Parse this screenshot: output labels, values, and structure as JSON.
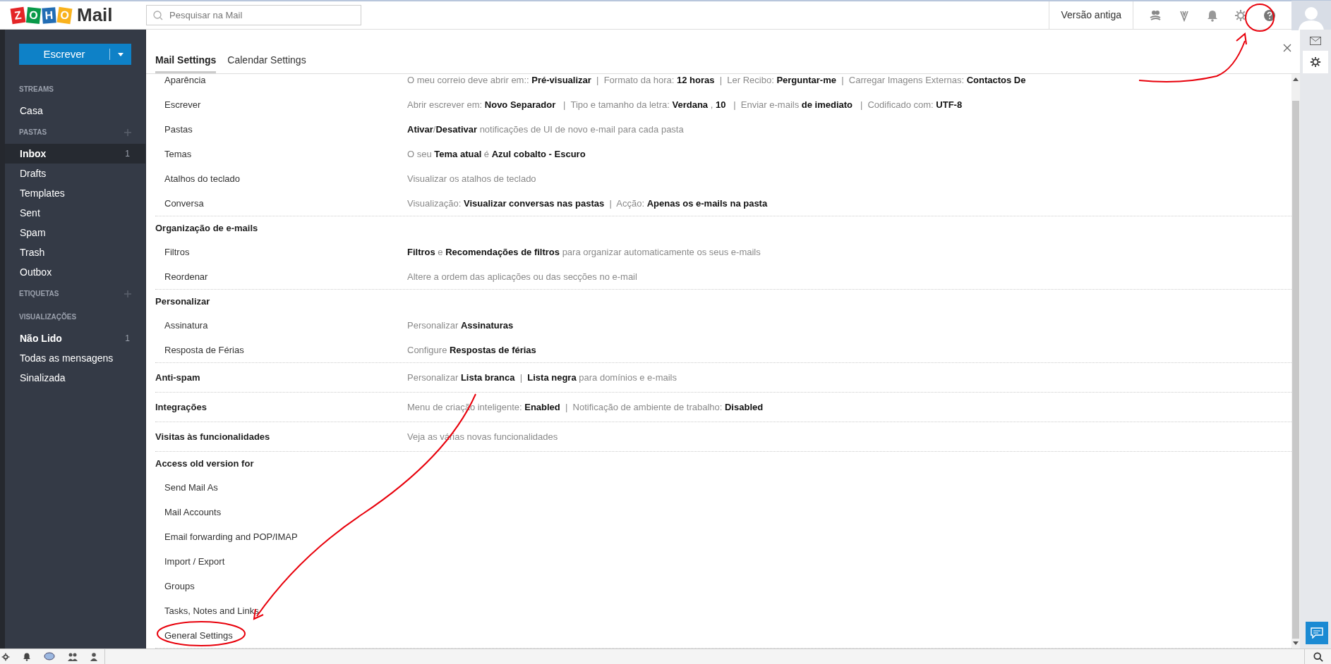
{
  "logo": {
    "letters": [
      {
        "char": "Z",
        "color": "#e42527"
      },
      {
        "char": "O",
        "color": "#089949"
      },
      {
        "char": "H",
        "color": "#226db4"
      },
      {
        "char": "O",
        "color": "#f9b21d"
      }
    ],
    "product": "Mail"
  },
  "search": {
    "placeholder": "Pesquisar na Mail"
  },
  "topbar": {
    "old_version": "Versão antiga"
  },
  "compose": {
    "label": "Escrever"
  },
  "sidebar": [
    {
      "kind": "header",
      "label": "STREAMS",
      "addable": false
    },
    {
      "kind": "item",
      "label": "Casa",
      "bold": false,
      "selected": false
    },
    {
      "kind": "header",
      "label": "PASTAS",
      "addable": true
    },
    {
      "kind": "item",
      "label": "Inbox",
      "count": "1",
      "bold": true,
      "selected": true
    },
    {
      "kind": "item",
      "label": "Drafts",
      "bold": false,
      "selected": false
    },
    {
      "kind": "item",
      "label": "Templates",
      "bold": false,
      "selected": false
    },
    {
      "kind": "item",
      "label": "Sent",
      "bold": false,
      "selected": false
    },
    {
      "kind": "item",
      "label": "Spam",
      "bold": false,
      "selected": false
    },
    {
      "kind": "item",
      "label": "Trash",
      "bold": false,
      "selected": false
    },
    {
      "kind": "item",
      "label": "Outbox",
      "bold": false,
      "selected": false
    },
    {
      "kind": "header",
      "label": "ETIQUETAS",
      "addable": true
    },
    {
      "kind": "header",
      "label": "VISUALIZAÇÕES",
      "addable": false
    },
    {
      "kind": "item",
      "label": "Não Lido",
      "count": "1",
      "bold": true,
      "selected": false
    },
    {
      "kind": "item",
      "label": "Todas as mensagens",
      "bold": false,
      "selected": false
    },
    {
      "kind": "item",
      "label": "Sinalizada",
      "bold": false,
      "selected": false
    }
  ],
  "tabs": [
    {
      "label": "Mail Settings",
      "selected": true
    },
    {
      "label": "Calendar Settings",
      "selected": false
    }
  ],
  "sections": [
    {
      "items": [
        {
          "label": "Aparência",
          "description": "O meu correio deve abrir em:: **Pré-visualizar**  |  Formato da hora: **12 horas**  |  Ler Recibo: **Perguntar-me**  |  Carregar Imagens Externas: **Contactos De**"
        },
        {
          "label": "Escrever",
          "description": "Abrir escrever em: **Novo Separador**   |  Tipo e tamanho da letra: **Verdana** , **10**   |  Enviar e-mails **de imediato**   |  Codificado com: **UTF-8**"
        },
        {
          "label": "Pastas",
          "description": "**Ativar**/**Desativar** notificações de UI de novo e-mail para cada pasta"
        },
        {
          "label": "Temas",
          "description": "O seu **Tema atual** é **Azul cobalto - Escuro**"
        },
        {
          "label": "Atalhos do teclado",
          "description": "Visualizar os atalhos de teclado"
        },
        {
          "label": "Conversa",
          "description": "Visualização: **Visualizar conversas nas pastas**  |  Acção: **Apenas os e-mails na pasta**"
        }
      ]
    },
    {
      "title": "Organização de e-mails",
      "items": [
        {
          "label": "Filtros",
          "description": "**Filtros** e **Recomendações de filtros** para organizar automaticamente os seus e-mails"
        },
        {
          "label": "Reordenar",
          "description": "Altere a ordem das aplicações ou das secções no e-mail"
        }
      ]
    },
    {
      "title": "Personalizar",
      "items": [
        {
          "label": "Assinatura",
          "description": "Personalizar **Assinaturas**"
        },
        {
          "label": "Resposta de Férias",
          "description": "Configure **Respostas de férias**"
        }
      ]
    },
    {
      "title": "Anti-spam",
      "description": "Personalizar **Lista branca**  |  **Lista negra** para domínios e e-mails"
    },
    {
      "title": "Integrações",
      "description": "Menu de criação inteligente: **Enabled**  |  Notificação de ambiente de trabalho: **Disabled**"
    },
    {
      "title": "Visitas às funcionalidades",
      "description": "Veja as várias novas funcionalidades"
    },
    {
      "title": "Access old version for",
      "items": [
        {
          "label": "Send Mail As"
        },
        {
          "label": "Mail Accounts"
        },
        {
          "label": "Email forwarding and POP/IMAP"
        },
        {
          "label": "Import / Export"
        },
        {
          "label": "Groups"
        },
        {
          "label": "Tasks, Notes and Links"
        },
        {
          "label": "General Settings"
        }
      ]
    }
  ]
}
